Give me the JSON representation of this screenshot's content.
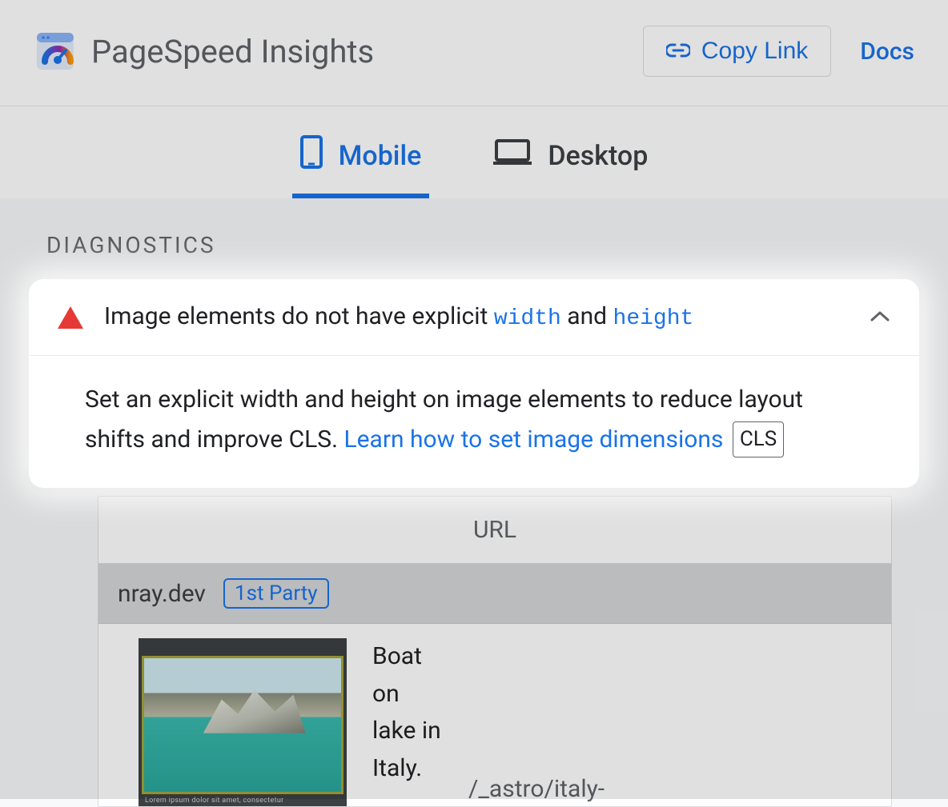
{
  "header": {
    "title": "PageSpeed Insights",
    "copy_link_label": "Copy Link",
    "docs_label": "Docs"
  },
  "tabs": {
    "mobile_label": "Mobile",
    "desktop_label": "Desktop",
    "active": "mobile"
  },
  "section": {
    "label": "DIAGNOSTICS"
  },
  "diagnostic": {
    "title_pre": "Image elements do not have explicit ",
    "code1": "width",
    "title_mid": " and ",
    "code2": "height",
    "body_text": "Set an explicit width and height on image elements to reduce layout shifts and improve CLS. ",
    "learn_link": "Learn how to set image dimensions",
    "badge": "CLS"
  },
  "table": {
    "header": "URL",
    "domain": "nray.dev",
    "party_badge": "1st Party",
    "row": {
      "desc": "Boat on lake in Italy.",
      "path": "/_astro/italy-"
    }
  }
}
